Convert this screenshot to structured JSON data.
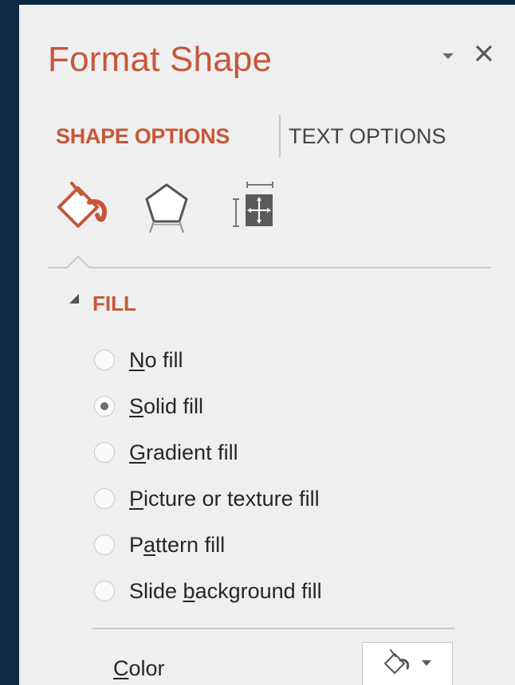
{
  "pane": {
    "title": "Format Shape",
    "title_bar_icons": [
      "chevron-down-icon",
      "close-icon"
    ]
  },
  "tabs": [
    {
      "label": "SHAPE OPTIONS",
      "active": true
    },
    {
      "label": "TEXT OPTIONS",
      "active": false
    }
  ],
  "category_icons": [
    "fill-line-icon",
    "effects-pentagon-icon",
    "size-properties-icon"
  ],
  "section": {
    "title": "FILL",
    "expanded": true,
    "options": [
      {
        "pre": "",
        "ul": "N",
        "post": "o fill",
        "checked": false
      },
      {
        "pre": "",
        "ul": "S",
        "post": "olid fill",
        "checked": true
      },
      {
        "pre": "",
        "ul": "G",
        "post": "radient fill",
        "checked": false
      },
      {
        "pre": "",
        "ul": "P",
        "post": "icture or texture fill",
        "checked": false
      },
      {
        "pre": "P",
        "ul": "a",
        "post": "ttern fill",
        "checked": false
      },
      {
        "pre": "Slide ",
        "ul": "b",
        "post": "ackground fill",
        "checked": false
      }
    ]
  },
  "color": {
    "pre": "",
    "ul": "C",
    "post": "olor",
    "button_icon": "paint-bucket-icon"
  },
  "colors": {
    "accent": "#c5573a",
    "panel_bg": "#efefef",
    "window_bg": "#0e2a45"
  }
}
